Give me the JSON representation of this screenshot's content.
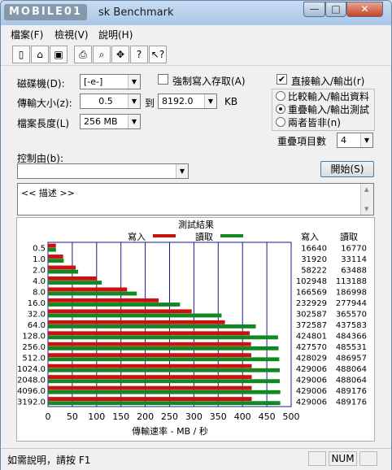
{
  "window": {
    "logo": "MOBILE01",
    "title": "sk Benchmark",
    "min": "—",
    "max": "□",
    "close": "✕"
  },
  "menu": [
    "檔案(F)",
    "檢視(V)",
    "說明(H)"
  ],
  "toolbar": [
    {
      "name": "new-icon",
      "glyph": "▯"
    },
    {
      "name": "open-icon",
      "glyph": "⌂"
    },
    {
      "name": "save-icon",
      "glyph": "▣"
    },
    {
      "name": "print-icon",
      "glyph": "⎙"
    },
    {
      "name": "print-preview-icon",
      "glyph": "⌕"
    },
    {
      "name": "move-icon",
      "glyph": "✥"
    },
    {
      "name": "help-icon",
      "glyph": "?"
    },
    {
      "name": "context-help-icon",
      "glyph": "↖?"
    }
  ],
  "form": {
    "drive_label": "磁碟機(D):",
    "drive_value": "[-e-]",
    "force_write_label": "強制寫入存取(A)",
    "transfer_label": "傳輸大小(z):",
    "transfer_from": "0.5",
    "to_label": "到",
    "transfer_to": "8192.0",
    "kb_label": "KB",
    "filelen_label": "檔案長度(L)",
    "filelen_value": "256 MB",
    "direct_io_label": "直接輸入/輸出(r)",
    "direct_io_checked": "✔",
    "mode_compare": "比較輸入/輸出資料",
    "mode_overlap": "重疊輸入/輸出測試",
    "mode_neither": "兩者皆非(n)",
    "queue_label": "重疊項目數",
    "queue_value": "4",
    "control_label": "控制由(b):",
    "start_button": "開始(S)",
    "desc_text": "<<    描述    >>"
  },
  "chart_data": {
    "type": "bar",
    "title": "測試結果",
    "legend_write": "寫入",
    "legend_read": "讀取",
    "xlabel": "傳輸速率 - MB / 秒",
    "xlim": [
      0,
      500
    ],
    "xticks": [
      0,
      50,
      100,
      150,
      200,
      250,
      300,
      350,
      400,
      450,
      500
    ],
    "categories": [
      "0.5",
      "1.0",
      "2.0",
      "4.0",
      "8.0",
      "16.0",
      "32.0",
      "64.0",
      "128.0",
      "256.0",
      "512.0",
      "1024.0",
      "2048.0",
      "4096.0",
      "3192.0"
    ],
    "write_kb": [
      16640,
      31920,
      58222,
      102948,
      166569,
      232929,
      302587,
      372587,
      424801,
      427570,
      428029,
      429006,
      429006,
      429006,
      429006
    ],
    "read_kb": [
      16770,
      33114,
      63488,
      113188,
      186998,
      277944,
      365570,
      437583,
      484366,
      485531,
      486957,
      488064,
      488064,
      489176,
      489176
    ],
    "write_header": "寫入",
    "read_header": "讀取",
    "colors": {
      "write": "#cc1111",
      "read": "#118822",
      "grid": "#1a1a8c"
    }
  },
  "status": {
    "help_text": "如需說明，請按 F1",
    "num": "NUM"
  }
}
